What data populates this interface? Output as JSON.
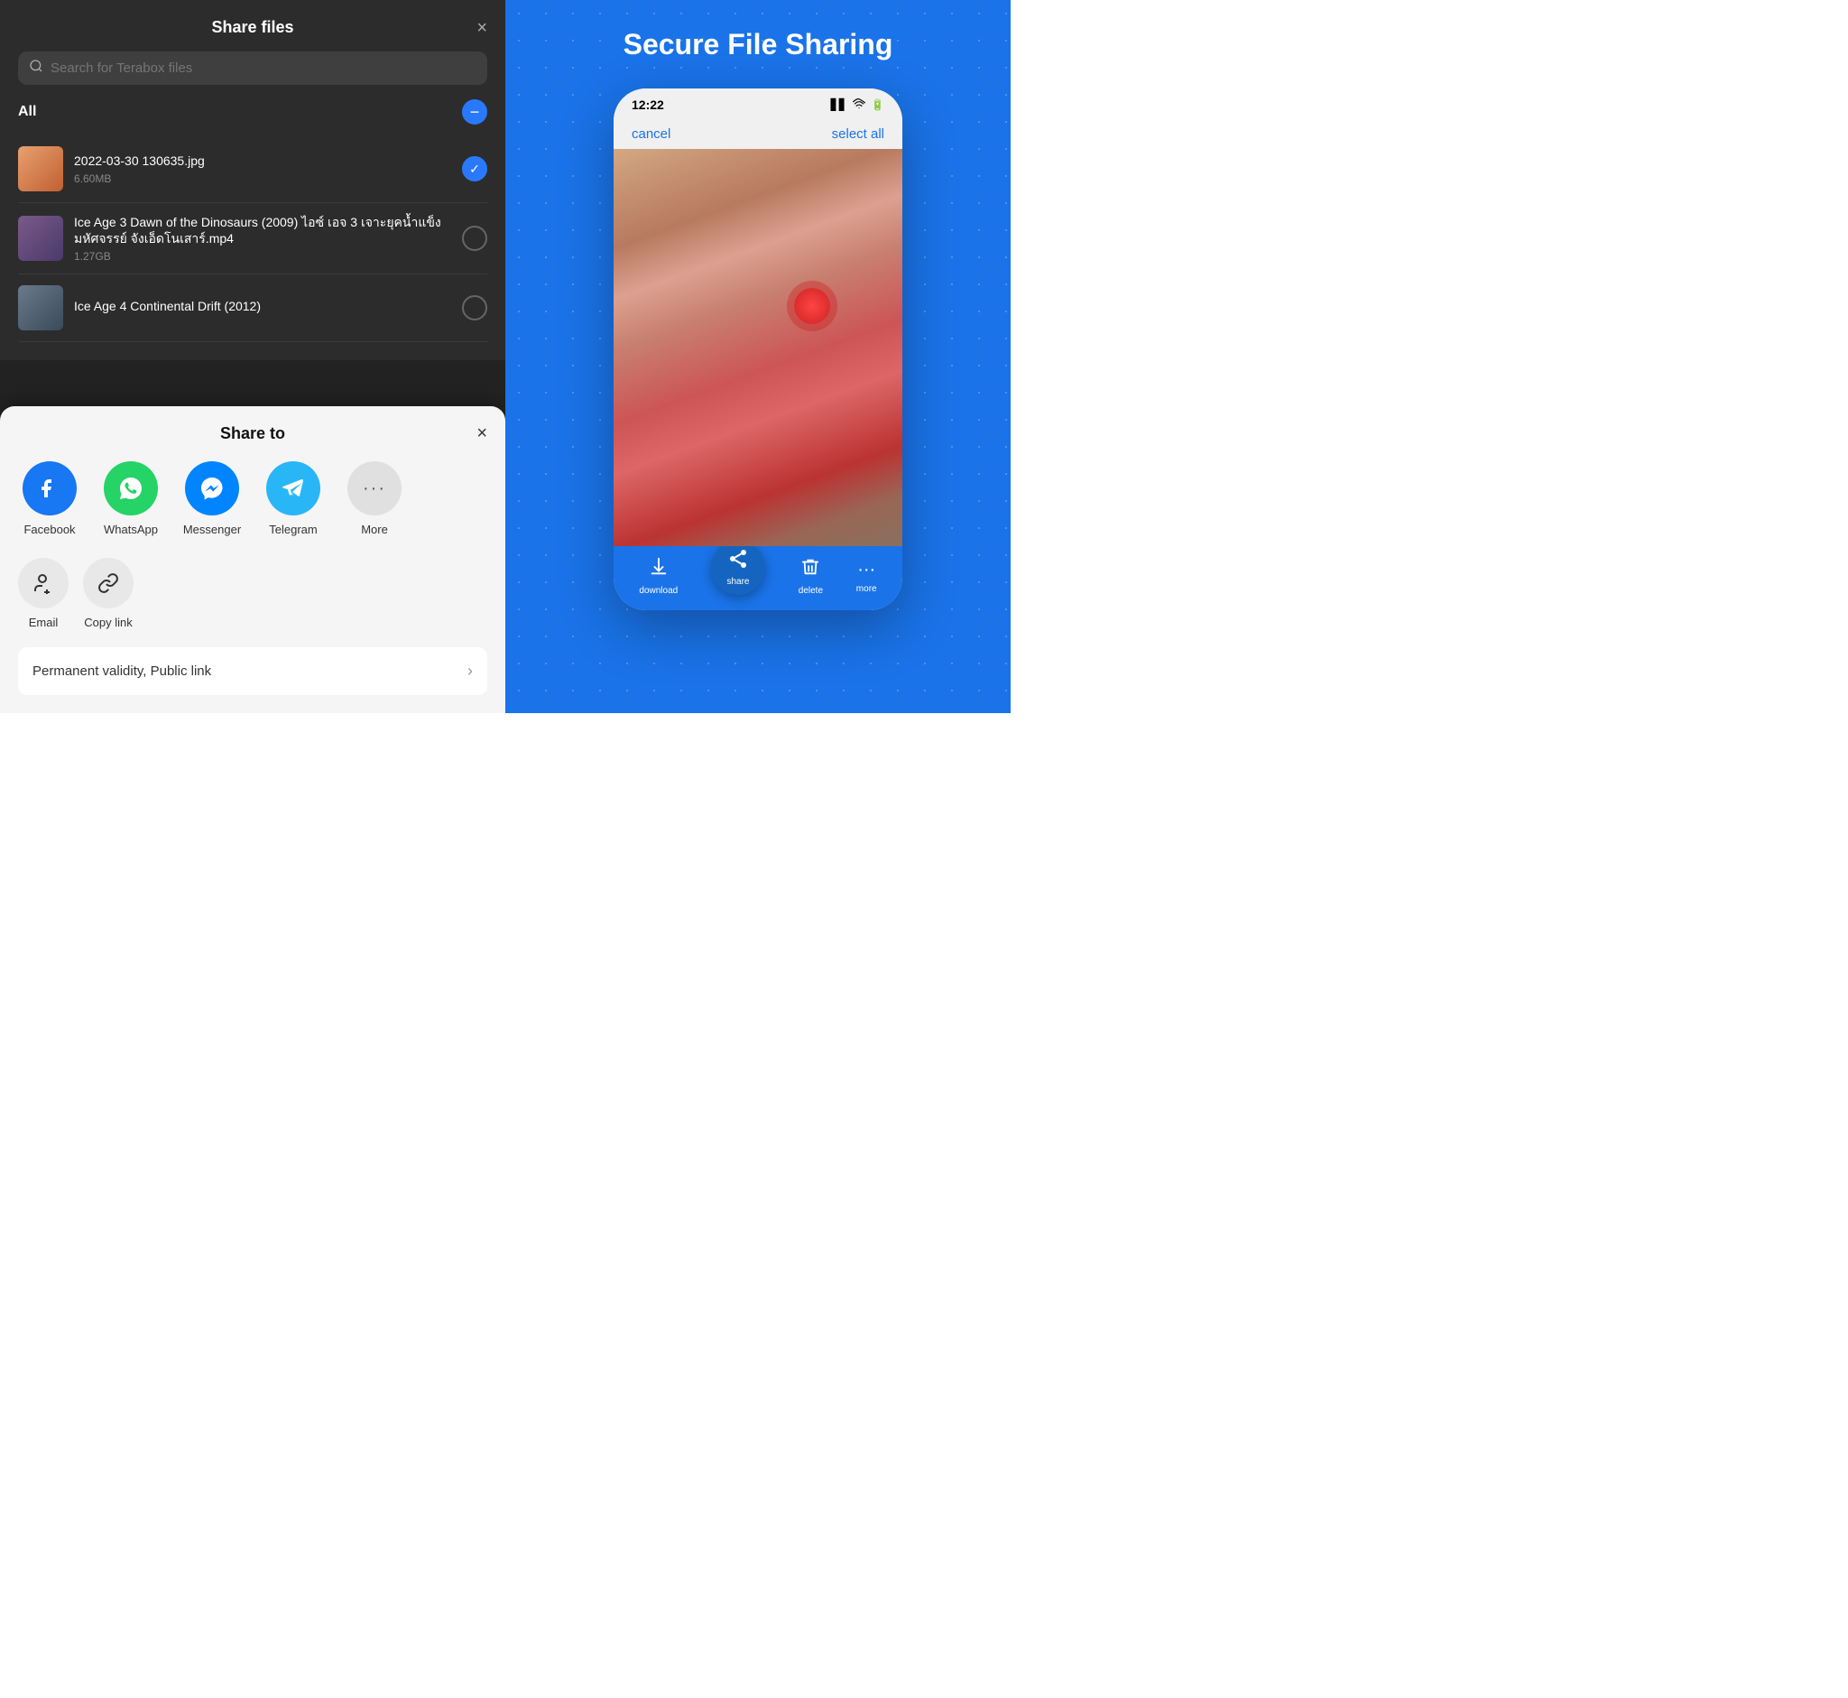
{
  "left": {
    "share_files_modal": {
      "title": "Share files",
      "close_label": "×",
      "search_placeholder": "Search for Terabox files",
      "all_label": "All",
      "files": [
        {
          "name": "2022-03-30 130635.jpg",
          "size": "6.60MB",
          "checked": true,
          "thumb_type": "orange"
        },
        {
          "name": "Ice Age 3 Dawn of the Dinosaurs (2009) ไอซ์ เอจ 3 เจาะยุคน้ำแข็ง มหัศจรรย์ จังเอ็ดโนเสาร์.mp4",
          "size": "1.27GB",
          "checked": false,
          "thumb_type": "dark"
        },
        {
          "name": "Ice Age 4 Continental Drift (2012)",
          "size": "",
          "checked": false,
          "thumb_type": "gray"
        }
      ]
    },
    "share_to_sheet": {
      "title": "Share to",
      "close_label": "×",
      "apps": [
        {
          "label": "Facebook",
          "type": "facebook"
        },
        {
          "label": "WhatsApp",
          "type": "whatsapp"
        },
        {
          "label": "Messenger",
          "type": "messenger"
        },
        {
          "label": "Telegram",
          "type": "telegram"
        },
        {
          "label": "More",
          "type": "more"
        }
      ],
      "actions": [
        {
          "label": "Email",
          "icon": "👤+"
        },
        {
          "label": "Copy link",
          "icon": "🔗"
        }
      ],
      "permanent_link": {
        "text": "Permanent validity, Public link",
        "chevron": "›"
      }
    }
  },
  "right": {
    "title": "Secure File Sharing",
    "phone": {
      "time": "12:22",
      "cancel_label": "cancel",
      "select_all_label": "select all",
      "bottom_actions": [
        {
          "label": "download",
          "icon": "⬇"
        },
        {
          "label": "share",
          "icon": "↗",
          "is_main": true
        },
        {
          "label": "delete",
          "icon": "🗑"
        },
        {
          "label": "more",
          "icon": "···"
        }
      ]
    }
  }
}
